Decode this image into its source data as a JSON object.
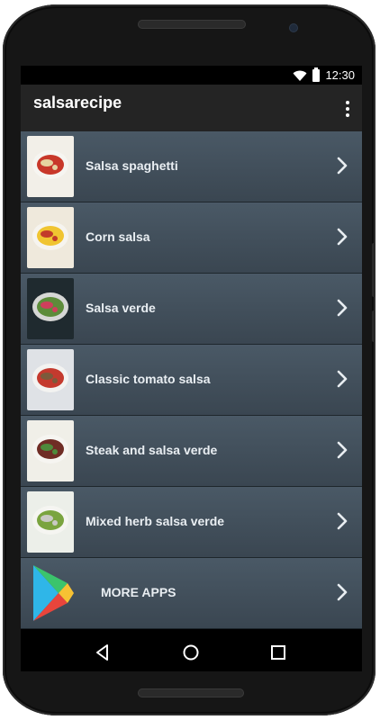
{
  "status_bar": {
    "time": "12:30",
    "wifi_icon": "wifi-icon",
    "battery_icon": "battery-icon"
  },
  "app_bar": {
    "title": "salsarecipe",
    "menu_icon": "overflow-menu-icon"
  },
  "recipes": [
    {
      "label": "Salsa spaghetti",
      "thumb_colors": [
        "#f2efe8",
        "#c8382a",
        "#e6d3a0"
      ]
    },
    {
      "label": "Corn salsa",
      "thumb_colors": [
        "#efe9dc",
        "#f0c431",
        "#c23a2a"
      ]
    },
    {
      "label": "Salsa verde",
      "thumb_colors": [
        "#1f2a2f",
        "#5d8c3a",
        "#cf3f5c"
      ]
    },
    {
      "label": "Classic tomato salsa",
      "thumb_colors": [
        "#dfe2e6",
        "#c43a2e",
        "#7c5a3b"
      ]
    },
    {
      "label": "Steak and salsa verde",
      "thumb_colors": [
        "#f0efe8",
        "#6f2d25",
        "#4e8a3b"
      ]
    },
    {
      "label": "Mixed herb salsa verde",
      "thumb_colors": [
        "#ecefe9",
        "#7aa43f",
        "#c9c9c4"
      ]
    }
  ],
  "more_apps": {
    "label": "MORE APPS",
    "icon": "google-play-icon"
  },
  "row_chevron": "chevron-right-icon",
  "nav_bar": {
    "back": "back-icon",
    "home": "home-icon",
    "recents": "recents-icon"
  }
}
